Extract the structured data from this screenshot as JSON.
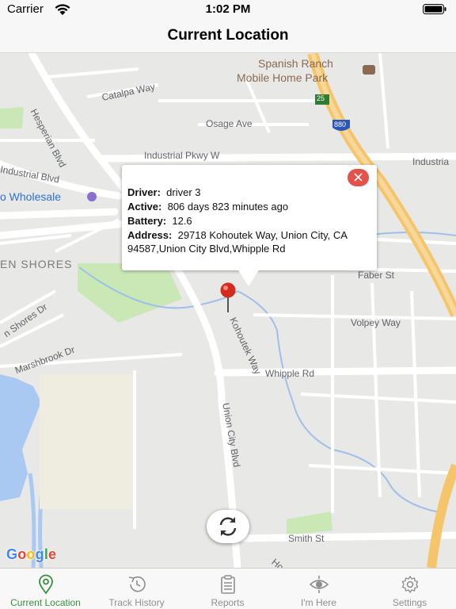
{
  "status_bar": {
    "carrier": "Carrier",
    "time": "1:02 PM"
  },
  "nav": {
    "title": "Current Location"
  },
  "map": {
    "labels": {
      "spanish_ranch_1": "Spanish Ranch",
      "spanish_ranch_2": "Mobile Home Park",
      "catalpa": "Catalpa Way",
      "hesperian": "Hesperian Blvd",
      "osage": "Osage Ave",
      "industrial_pkwy": "Industrial Pkwy W",
      "industrial_right": "Industria",
      "industrial_blvd": "Industrial Blvd",
      "wholesale": "o Wholesale",
      "shores": "EN SHORES",
      "shores_dr": "n Shores Dr",
      "marshbrook": "Marshbrook Dr",
      "faber": "Faber St",
      "volpey": "Volpey Way",
      "kohoutek": "Kohoutek Way",
      "whipple": "Whipple Rd",
      "union_city": "Union City Blvd",
      "smith": "Smith St",
      "route_25": "25",
      "route_880": "880",
      "bottom_cut": "Ho"
    },
    "colors": {
      "water": "#a9c9f3",
      "park": "#c9e8b5",
      "road": "#ffffff",
      "highway": "#f4c56b"
    }
  },
  "callout": {
    "driver_label": "Driver:",
    "driver_value": "driver 3",
    "active_label": "Active:",
    "active_value": "806 days 823 minutes  ago",
    "battery_label": "Battery:",
    "battery_value": "12.6",
    "address_label": "Address:",
    "address_value": "29718 Kohoutek Way, Union City, CA 94587,Union City Blvd,Whipple Rd",
    "close_color": "#e5514b"
  },
  "google": {
    "letters": [
      "G",
      "o",
      "o",
      "g",
      "l",
      "e"
    ]
  },
  "tabs": [
    {
      "label": "Current Location",
      "icon": "location-pin-icon",
      "active": true
    },
    {
      "label": "Track History",
      "icon": "history-icon",
      "active": false
    },
    {
      "label": "Reports",
      "icon": "clipboard-icon",
      "active": false
    },
    {
      "label": "I'm Here",
      "icon": "eye-target-icon",
      "active": false
    },
    {
      "label": "Settings",
      "icon": "gear-icon",
      "active": false
    }
  ],
  "accent_color": "#3a8f3a"
}
